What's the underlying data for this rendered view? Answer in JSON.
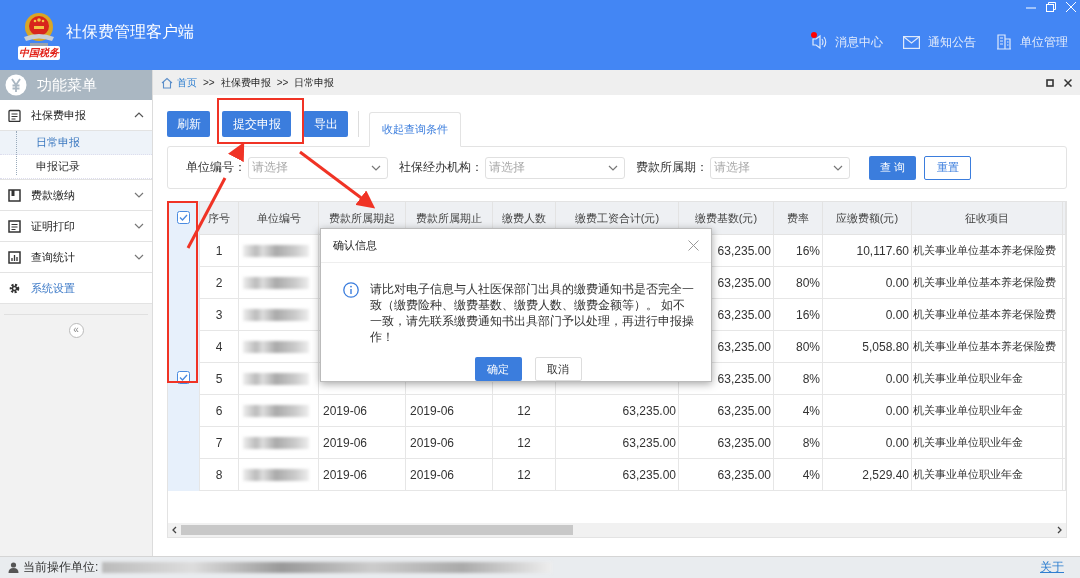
{
  "header": {
    "logo_caption": "中国税务",
    "title": "社保费管理客户端",
    "nav": [
      {
        "label": "消息中心",
        "unread": true
      },
      {
        "label": "通知公告",
        "unread": false
      },
      {
        "label": "单位管理",
        "unread": false
      }
    ]
  },
  "sidebar": {
    "title": "功能菜单",
    "collapse_label": "«",
    "items": [
      {
        "label": "社保费申报",
        "kind": "menu",
        "expanded": true,
        "children": [
          {
            "label": "日常申报",
            "selected": true
          },
          {
            "label": "申报记录",
            "selected": false
          }
        ]
      },
      {
        "label": "费款缴纳",
        "kind": "menu",
        "expanded": false
      },
      {
        "label": "证明打印",
        "kind": "menu",
        "expanded": false
      },
      {
        "label": "查询统计",
        "kind": "menu",
        "expanded": false
      },
      {
        "label": "系统设置",
        "kind": "link"
      }
    ]
  },
  "breadcrumb": [
    {
      "label": "首页",
      "kind": "link"
    },
    {
      "label": ">>",
      "kind": "separator"
    },
    {
      "label": "社保费申报",
      "kind": "text"
    },
    {
      "label": ">>",
      "kind": "separator"
    },
    {
      "label": "日常申报",
      "kind": "text"
    }
  ],
  "toolbar": {
    "buttons": [
      "刷新",
      "提交申报",
      "导出"
    ],
    "toggle": "收起查询条件"
  },
  "filters": {
    "fields": [
      {
        "label": "单位编号：",
        "placeholder": "请选择"
      },
      {
        "label": "社保经办机构：",
        "placeholder": "请选择"
      },
      {
        "label": "费款所属期：",
        "placeholder": "请选择"
      }
    ],
    "buttons": [
      {
        "label": "查 询",
        "primary": true
      },
      {
        "label": "重置",
        "primary": false
      }
    ]
  },
  "table": {
    "all_selected": true,
    "columns": [
      "序号",
      "单位编号",
      "费款所属期起",
      "费款所属期止",
      "缴费人数",
      "缴费工资合计(元)",
      "缴费基数(元)",
      "费率",
      "应缴费额(元)",
      "征收项目"
    ],
    "rows": [
      {
        "selected": false,
        "index": "1",
        "base": "63,235.00",
        "rate": "16%",
        "amount": "10,117.60",
        "item": "机关事业单位基本养老保险费"
      },
      {
        "selected": false,
        "index": "2",
        "base": "63,235.00",
        "rate": "80%",
        "amount": "0.00",
        "item": "机关事业单位基本养老保险费"
      },
      {
        "selected": false,
        "index": "3",
        "base": "63,235.00",
        "rate": "16%",
        "amount": "0.00",
        "item": "机关事业单位基本养老保险费"
      },
      {
        "selected": false,
        "index": "4",
        "base": "63,235.00",
        "rate": "80%",
        "amount": "5,058.80",
        "item": "机关事业单位基本养老保险费"
      },
      {
        "selected": true,
        "index": "5",
        "base": "63,235.00",
        "rate": "8%",
        "amount": "0.00",
        "item": "机关事业单位职业年金"
      },
      {
        "selected": false,
        "index": "6",
        "period_start": "2019-06",
        "period_end": "2019-06",
        "headcount": "12",
        "wage_total": "63,235.00",
        "base": "63,235.00",
        "rate": "4%",
        "amount": "0.00",
        "item": "机关事业单位职业年金"
      },
      {
        "selected": false,
        "index": "7",
        "period_start": "2019-06",
        "period_end": "2019-06",
        "headcount": "12",
        "wage_total": "63,235.00",
        "base": "63,235.00",
        "rate": "8%",
        "amount": "0.00",
        "item": "机关事业单位职业年金"
      },
      {
        "selected": false,
        "index": "8",
        "period_start": "2019-06",
        "period_end": "2019-06",
        "headcount": "12",
        "wage_total": "63,235.00",
        "base": "63,235.00",
        "rate": "4%",
        "amount": "2,529.40",
        "item": "机关事业单位职业年金"
      }
    ]
  },
  "dialog": {
    "title": "确认信息",
    "message": "请比对电子信息与人社医保部门出具的缴费通知书是否完全一致（缴费险种、缴费基数、缴费人数、缴费金额等）。 如不一致，请先联系缴费通知书出具部门予以处理，再进行申报操作！",
    "buttons": [
      {
        "label": "确定",
        "primary": true
      },
      {
        "label": "取消",
        "primary": false
      }
    ]
  },
  "status_bar": {
    "label": "当前操作单位:",
    "link": "关于"
  }
}
